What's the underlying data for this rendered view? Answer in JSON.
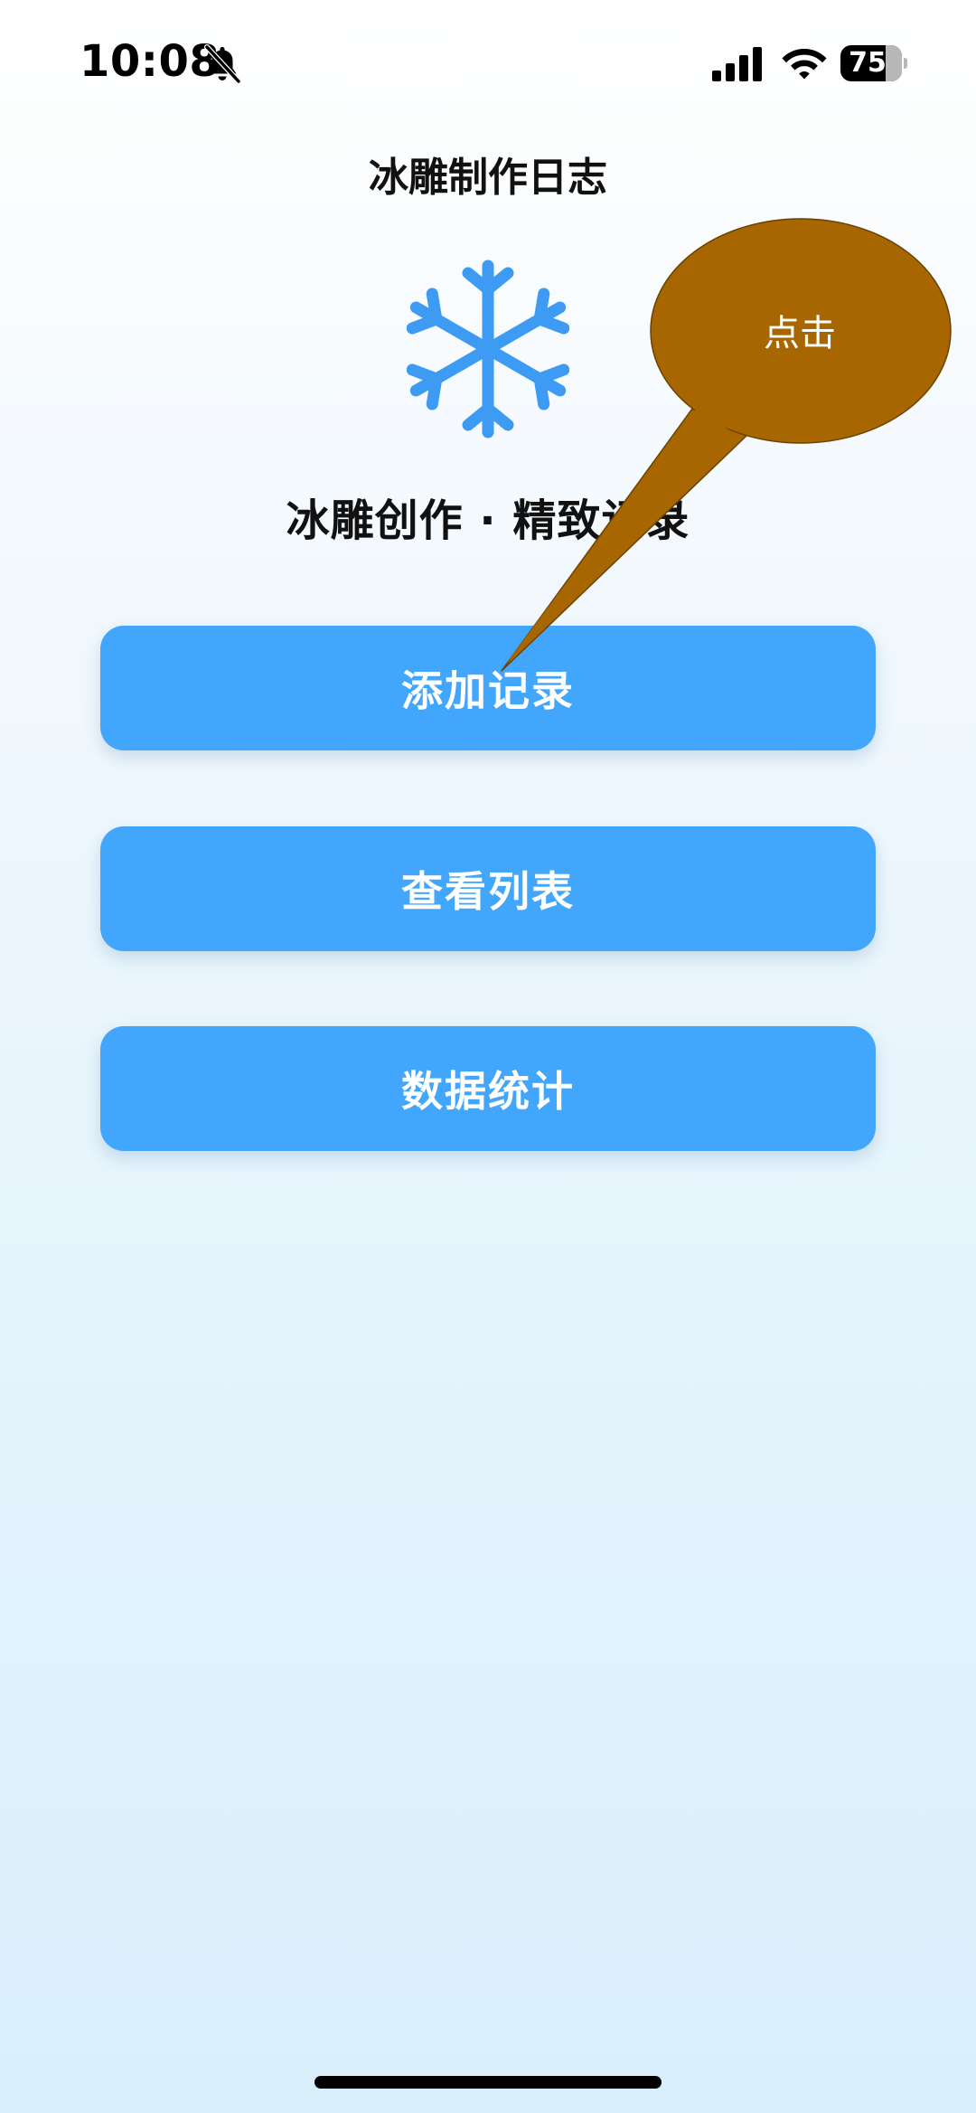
{
  "status_bar": {
    "time": "10:08",
    "battery_level": "75",
    "icons": [
      "bell-slash-icon",
      "signal-icon",
      "wifi-icon",
      "battery-icon"
    ]
  },
  "header": {
    "title": "冰雕制作日志",
    "logo_icon": "snowflake-icon",
    "subtitle": "冰雕创作 · 精致记录"
  },
  "buttons": {
    "add": "添加记录",
    "list": "查看列表",
    "stats": "数据统计"
  },
  "annotation": {
    "text": "点击"
  },
  "colors": {
    "button": "#42a6fd",
    "icon": "#3d9bf3",
    "callout": "#a76600"
  }
}
